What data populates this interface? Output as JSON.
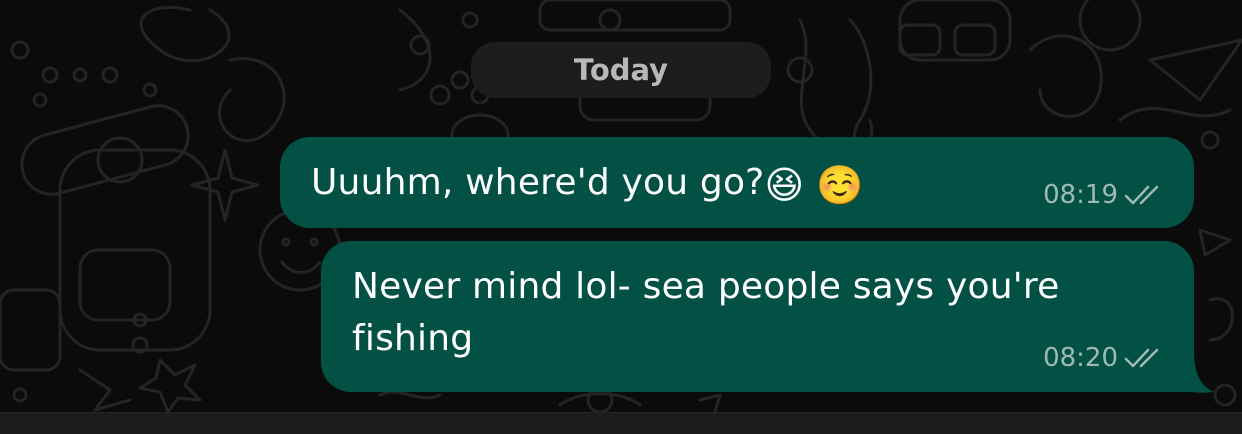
{
  "chat": {
    "date_label": "Today",
    "messages": [
      {
        "text": "Uuuhm, where'd you go?",
        "emojis": [
          "😆",
          "☺️"
        ],
        "time": "08:19",
        "status": "delivered-double-check"
      },
      {
        "text": "Never mind lol- sea people says you're fishing",
        "time": "08:20",
        "status": "delivered-double-check"
      }
    ]
  },
  "colors": {
    "background": "#0b0b0b",
    "outgoing_bubble": "#025144",
    "date_pill": "#1d1d1d",
    "meta_text": "#9fb9b3"
  },
  "icons": {
    "read_status": "double-check-icon",
    "wallpaper": "doodle-pattern"
  }
}
